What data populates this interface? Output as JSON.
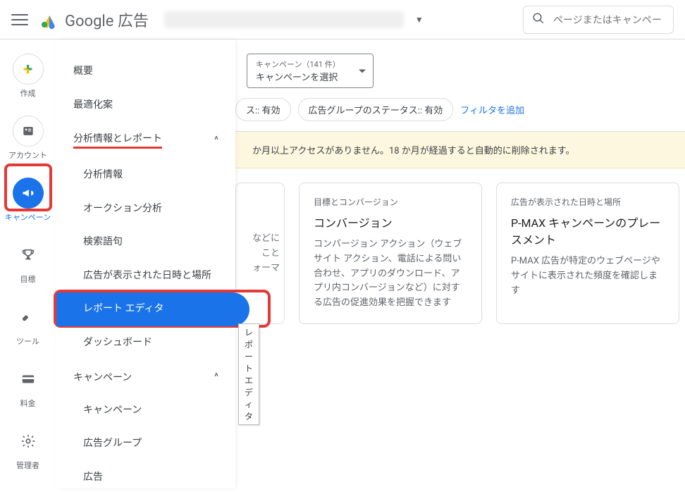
{
  "topbar": {
    "brand": "Google 広告",
    "search_placeholder": "ページまたはキャンペー"
  },
  "leftrail": {
    "create": "作成",
    "account": "アカウント",
    "campaign": "キャンペーン",
    "goals": "目標",
    "tools": "ツール",
    "billing": "料金",
    "admin": "管理者"
  },
  "sidemenu": {
    "overview": "概要",
    "recommendations": "最適化案",
    "insights_reports": "分析情報とレポート",
    "insights": "分析情報",
    "auction": "オークション分析",
    "search_terms": "検索語句",
    "when_where": "広告が表示された日時と場所",
    "report_editor": "レポート エディタ",
    "dashboard": "ダッシュボード",
    "campaigns_section": "キャンペーン",
    "campaigns": "キャンペーン",
    "ad_groups": "広告グループ",
    "ads": "広告"
  },
  "tooltip": {
    "report_editor": "レポート エディタ"
  },
  "filter": {
    "campaign_count_label": "キャンペーン（141 件）",
    "campaign_select": "キャンペーンを選択",
    "chip_status_right": "ス:: 有効",
    "chip_adgroup_status": "広告グループのステータス:: 有効",
    "add_filter": "フィルタを追加"
  },
  "banner": {
    "text_fragment": "か月以上アクセスがありません。18 か月が経過すると自動的に削除されます。"
  },
  "cards": {
    "left_fragment_lines": [
      "などに",
      "こと",
      "ォーマ"
    ],
    "conv": {
      "eyebrow": "目標とコンバージョン",
      "title": "コンバージョン",
      "body": "コンバージョン アクション（ウェブサイト アクション、電話による問い合わせ、アプリのダウンロード、アプリ内コンバージョンなど）に対する広告の促進効果を把握できます"
    },
    "pmax": {
      "eyebrow": "広告が表示された日時と場所",
      "title": "P-MAX キャンペーンのプレースメント",
      "body": "P-MAX 広告が特定のウェブページやサイトに表示された頻度を確認します"
    }
  }
}
